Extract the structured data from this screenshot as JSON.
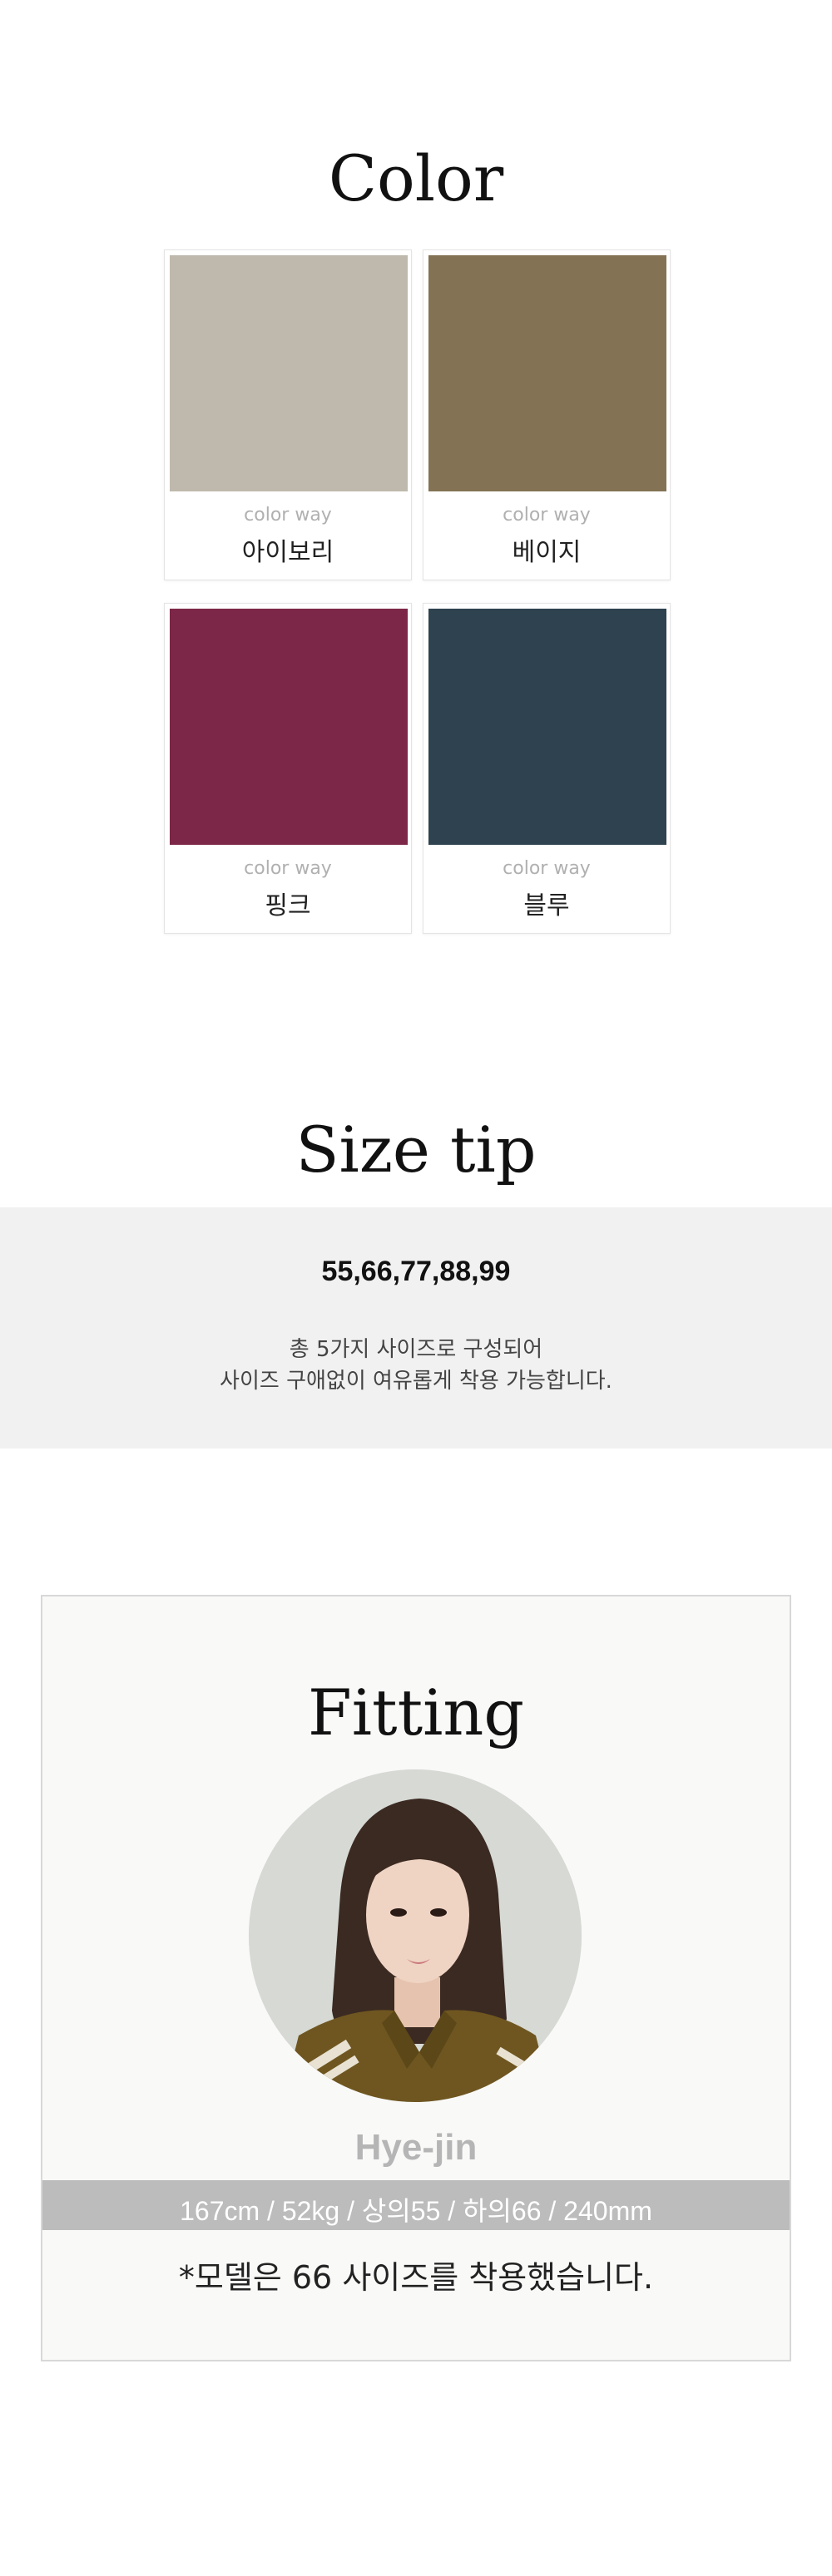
{
  "color_section": {
    "title": "Color",
    "swatches": [
      {
        "caption": "color way",
        "name": "아이보리",
        "color": "#bfb9ad"
      },
      {
        "caption": "color way",
        "name": "베이지",
        "color": "#837354"
      },
      {
        "caption": "color way",
        "name": "핑크",
        "color": "#7d2748"
      },
      {
        "caption": "color way",
        "name": "블루",
        "color": "#2e4250"
      }
    ]
  },
  "size_section": {
    "title": "Size tip",
    "sizes": "55,66,77,88,99",
    "desc_line1": "총 5가지 사이즈로 구성되어",
    "desc_line2": "사이즈 구애없이 여유롭게 착용 가능합니다."
  },
  "fitting_section": {
    "title": "Fitting",
    "model_name": "Hye-jin",
    "model_stats": "167cm / 52kg / 상의55 / 하의66 / 240mm",
    "note": "*모델은 66 사이즈를 착용했습니다."
  }
}
